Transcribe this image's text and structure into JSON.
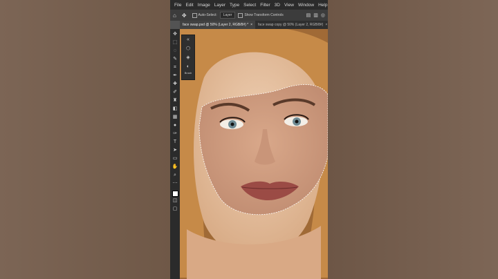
{
  "menu": [
    "File",
    "Edit",
    "Image",
    "Layer",
    "Type",
    "Select",
    "Filter",
    "3D",
    "View",
    "Window",
    "Help"
  ],
  "options": {
    "auto_select_label": "Auto-Select:",
    "auto_select_value": "Layer",
    "transform_label": "Show Transform Controls"
  },
  "tabs": [
    {
      "label": "face swap.psd @ 50% (Layer 2, RGB/8#) *",
      "close": "×"
    },
    {
      "label": "face swap copy @ 50% (Layer 2, RGB/8#)",
      "close": "×"
    }
  ],
  "panel": {
    "brush_label": "Brush"
  },
  "colors": {
    "psBg": "#535353",
    "menuBg": "#2b2b2b",
    "accent": "#31a8ff"
  }
}
